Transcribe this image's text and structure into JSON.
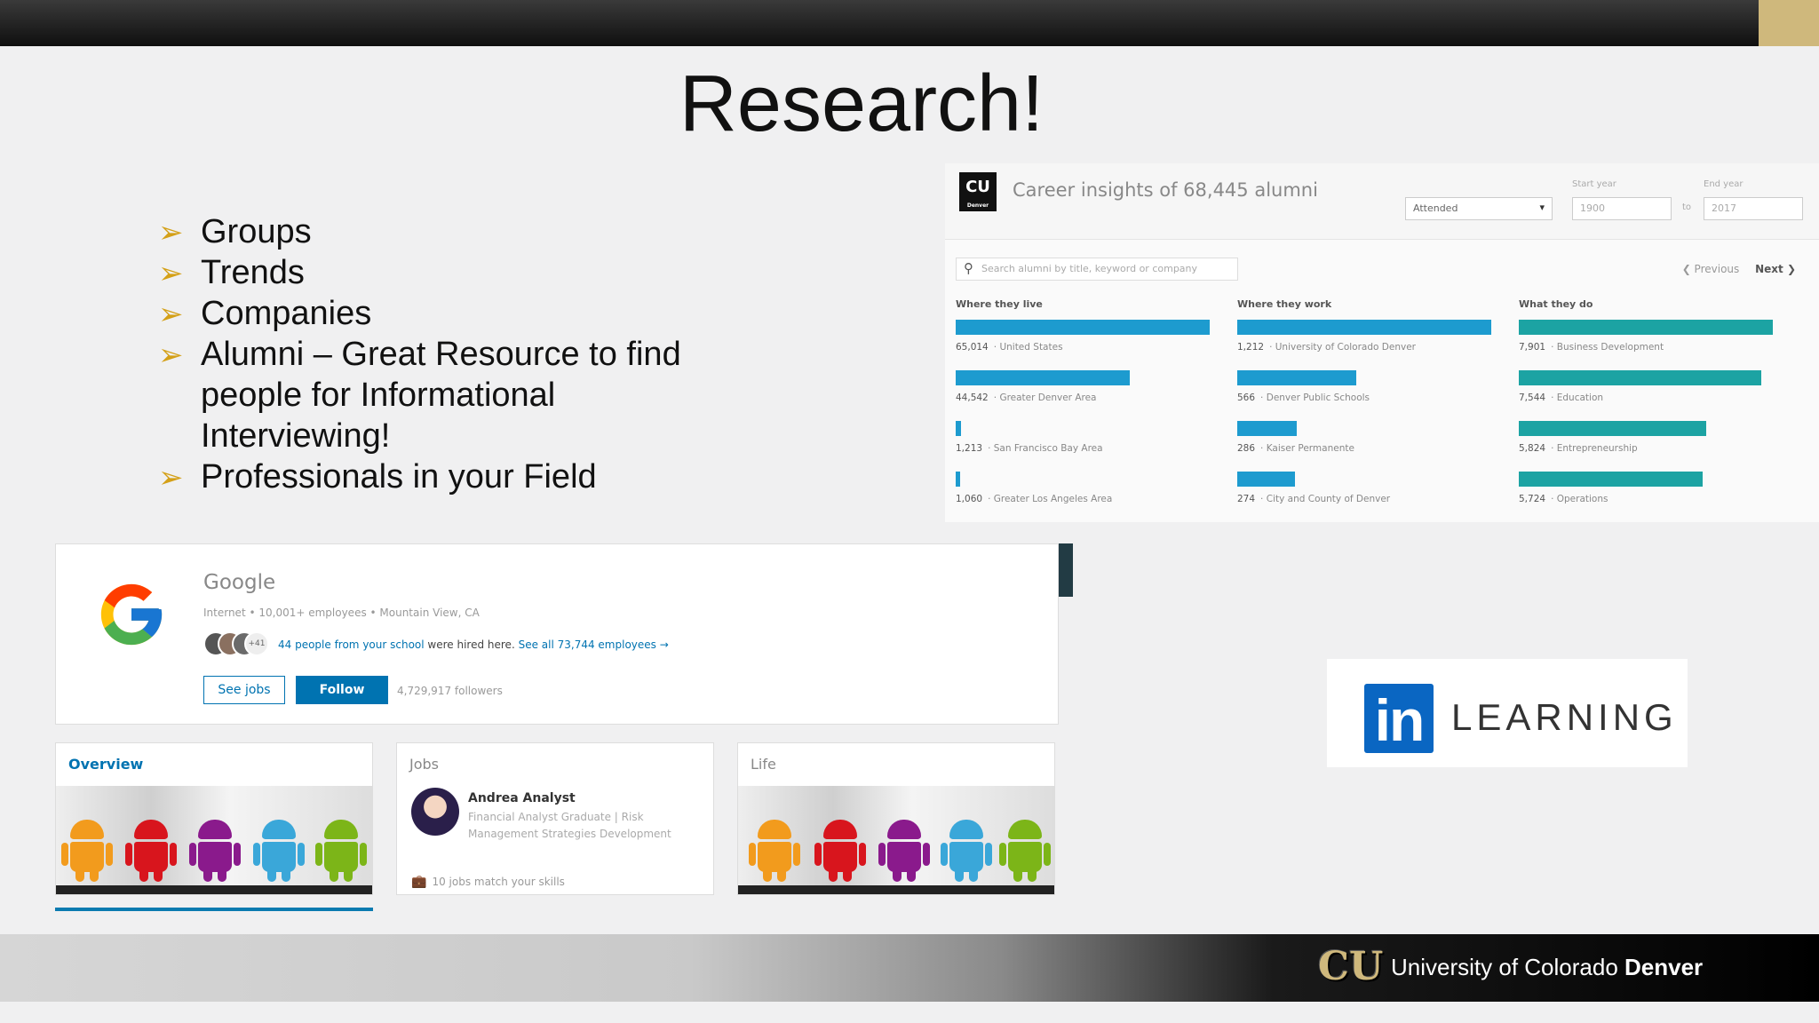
{
  "slide": {
    "title": "Research!",
    "bullets": [
      "Groups",
      "Trends",
      "Companies",
      "Alumni – Great Resource to find",
      "people for Informational",
      "Interviewing!",
      "Professionals in your Field"
    ],
    "bullet_color": "#d4a017",
    "accent_gold": "#cfb87c"
  },
  "alumni": {
    "logo_text": "CU",
    "logo_sub": "Denver",
    "title": "Career insights of 68,445 alumni",
    "select_value": "Attended",
    "start_label": "Start year",
    "start_value": "1900",
    "to_label": "to",
    "end_label": "End year",
    "end_value": "2017",
    "search_placeholder": "Search alumni by title, keyword or company",
    "prev": "❮ Previous",
    "next": "Next ❯",
    "columns": [
      {
        "heading": "Where they live",
        "color": "#1d9bcf",
        "rows": [
          {
            "count": "65,014",
            "label": "United States",
            "fraction": 1.0
          },
          {
            "count": "44,542",
            "label": "Greater Denver Area",
            "fraction": 0.685
          },
          {
            "count": "1,213",
            "label": "San Francisco Bay Area",
            "fraction": 0.02
          },
          {
            "count": "1,060",
            "label": "Greater Los Angeles Area",
            "fraction": 0.016
          }
        ]
      },
      {
        "heading": "Where they work",
        "color": "#1d9bcf",
        "rows": [
          {
            "count": "1,212",
            "label": "University of Colorado Denver",
            "fraction": 1.0
          },
          {
            "count": "566",
            "label": "Denver Public Schools",
            "fraction": 0.467
          },
          {
            "count": "286",
            "label": "Kaiser Permanente",
            "fraction": 0.236
          },
          {
            "count": "274",
            "label": "City and County of Denver",
            "fraction": 0.226
          }
        ]
      },
      {
        "heading": "What they do",
        "color": "#1ca3a3",
        "rows": [
          {
            "count": "7,901",
            "label": "Business Development",
            "fraction": 1.0
          },
          {
            "count": "7,544",
            "label": "Education",
            "fraction": 0.955
          },
          {
            "count": "5,824",
            "label": "Entrepreneurship",
            "fraction": 0.737
          },
          {
            "count": "5,724",
            "label": "Operations",
            "fraction": 0.724
          }
        ]
      }
    ]
  },
  "google": {
    "name": "Google",
    "meta": "Internet • 10,001+ employees • Mountain View, CA",
    "faces_more": "+41",
    "hired_prefix": "44 people from your school",
    "hired_mid": " were hired here. ",
    "hired_link": "See all 73,744 employees →",
    "see_jobs": "See jobs",
    "follow": "Follow",
    "followers": "4,729,917 followers",
    "tiles": {
      "overview": "Overview",
      "jobs": "Jobs",
      "life": "Life",
      "analyst_name": "Andrea Analyst",
      "analyst_desc": "Financial Analyst Graduate | Risk Management Strategies Development",
      "jobs_match": "10 jobs match your skills"
    },
    "brand_blue": "#0073b1"
  },
  "learning": {
    "in": "in",
    "word": "LEARNING",
    "brand": "#0a66c2"
  },
  "footer": {
    "logo": "CU",
    "text_plain": "University of Colorado ",
    "text_bold": "Denver"
  }
}
